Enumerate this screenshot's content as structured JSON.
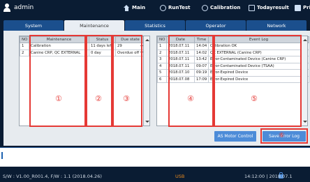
{
  "topbar": {
    "user": "admin",
    "nav": [
      {
        "label": "Main",
        "icon": "home-icon"
      },
      {
        "label": "RunTest",
        "icon": "runtest-icon"
      },
      {
        "label": "Calibration",
        "icon": "calibration-icon"
      },
      {
        "label": "Todayresult",
        "icon": "calendar-icon"
      },
      {
        "label": "Prin",
        "icon": "print-icon"
      }
    ]
  },
  "tabs": [
    "System",
    "Maintenance",
    "Statistics",
    "Operator",
    "Network"
  ],
  "active_tab": "Maintenance",
  "maintenance_table": {
    "headers": [
      "NO",
      "Maintenance",
      "Status",
      "Due state"
    ],
    "rows": [
      {
        "no": "1",
        "item": "Calibration",
        "status": "11 days left",
        "due": "29"
      },
      {
        "no": "2",
        "item": "Canine CRP, QC EXTERNAL",
        "status": "0 day",
        "due": "Overdue off"
      }
    ]
  },
  "event_table": {
    "headers": [
      "NO",
      "Date",
      "Time",
      "Event Log"
    ],
    "rows": [
      {
        "no": "1",
        "date": "2018.07.11",
        "time": "14:04",
        "event": "Calibration OK"
      },
      {
        "no": "2",
        "date": "2018.07.11",
        "time": "14:02",
        "event": "QC EXTERNAL (Canine CRP)"
      },
      {
        "no": "3",
        "date": "2018.07.11",
        "time": "13:42",
        "event": "Error-Contaminated Device (Canine CRP)"
      },
      {
        "no": "4",
        "date": "2018.07.11",
        "time": "09:07",
        "event": "Error-Contaminated Device (TSAA)"
      },
      {
        "no": "5",
        "date": "2018.07.10",
        "time": "09:19",
        "event": "Error-Expired Device"
      },
      {
        "no": "6",
        "date": "2018.07.08",
        "time": "17:09",
        "event": "Error-Expired Device"
      }
    ]
  },
  "markers": [
    "①",
    "②",
    "③",
    "④",
    "⑤",
    "⑥"
  ],
  "buttons": {
    "motor": "AS Motor Control",
    "save": "Save Error Log"
  },
  "status": {
    "version": "S/W : V1.00_R001.4, F/W : 1.1 (2018.04.26)",
    "usb": "USB",
    "datetime": "14:12:00 | 2018.07.1"
  },
  "colors": {
    "background": "#0a1c33",
    "tab": "#1b4f8d",
    "button": "#4d8cd8",
    "highlight": "#e53935",
    "status_ok": "#28a745",
    "usb": "#e8891e"
  }
}
